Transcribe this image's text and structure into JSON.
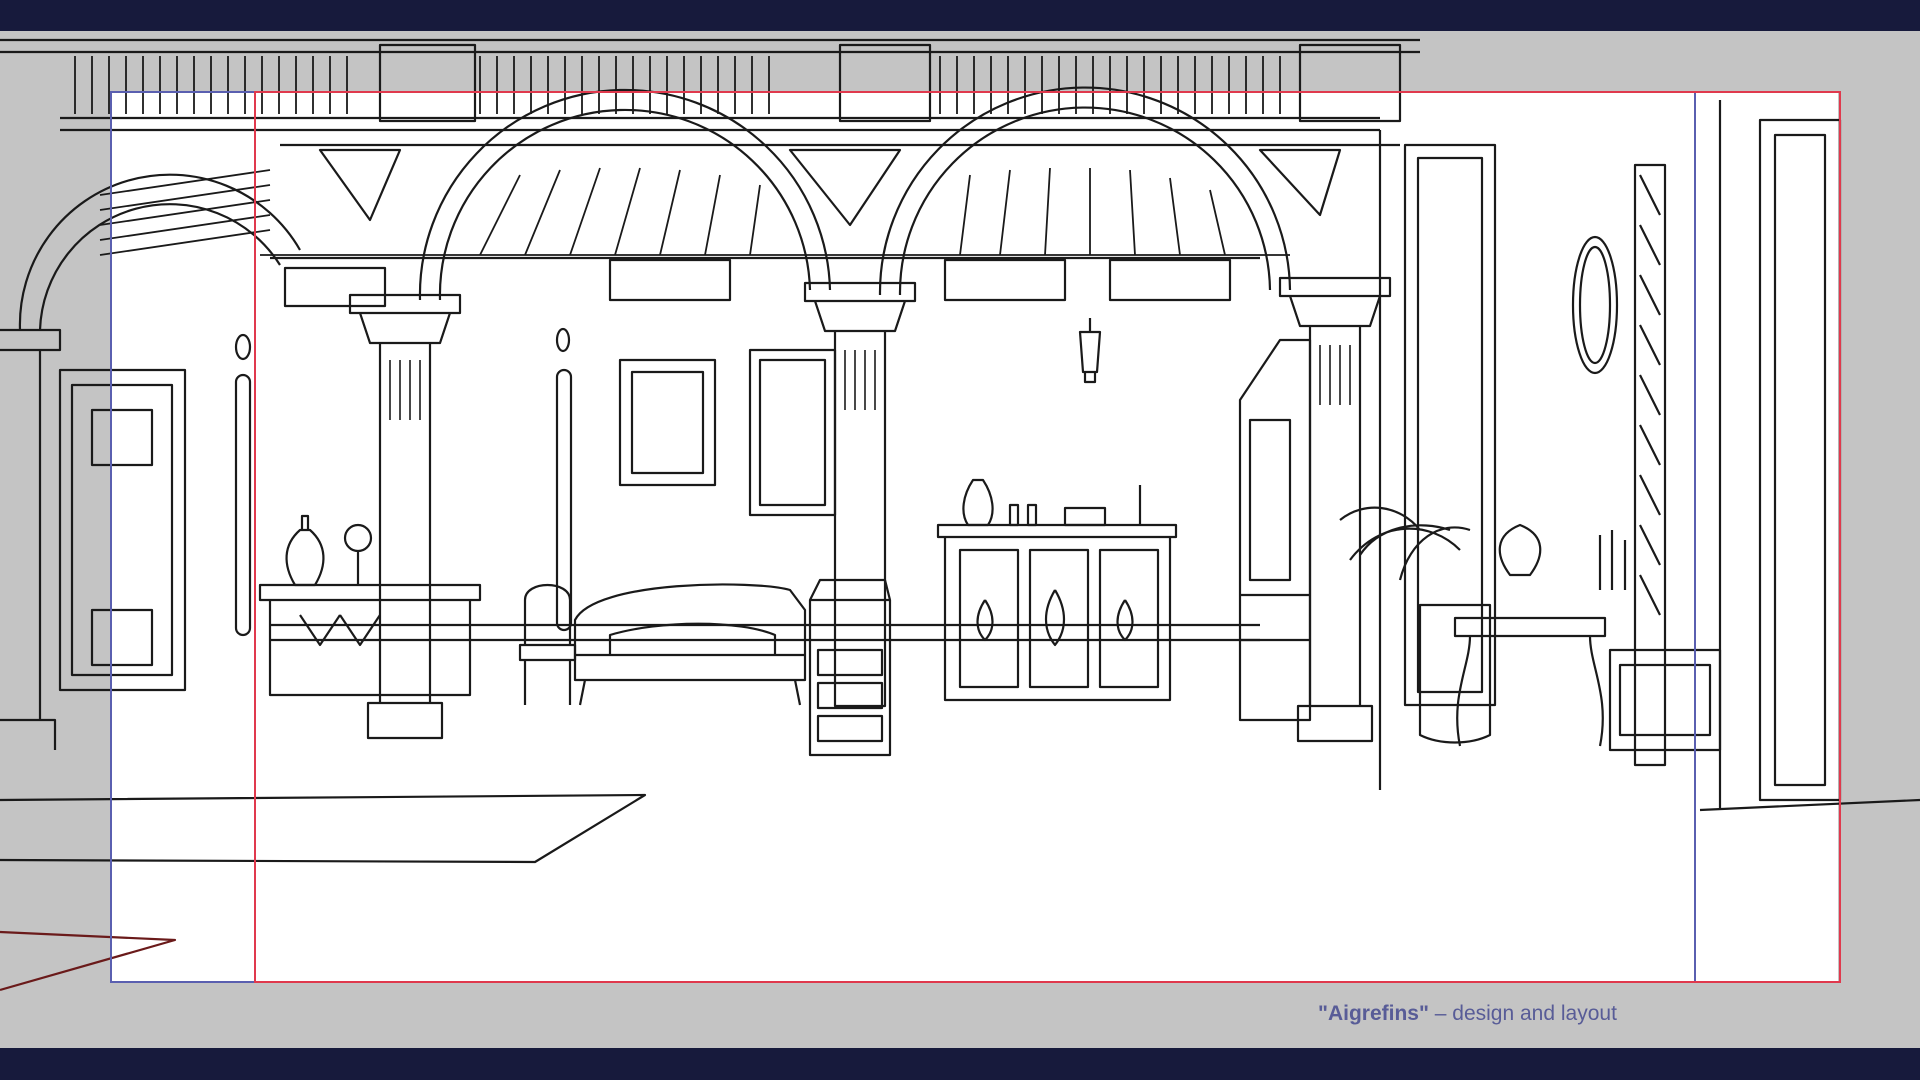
{
  "caption": {
    "title": "\"Aigrefins\"",
    "subtitle": " – design and layout"
  },
  "colors": {
    "frame_bar": "#171a3c",
    "background": "#c4c4c4",
    "paper": "#ffffff",
    "ink": "#1a1a1a",
    "guide_blue": "#5a5fb0",
    "guide_red": "#e0394d",
    "caption_text": "#585c97"
  }
}
